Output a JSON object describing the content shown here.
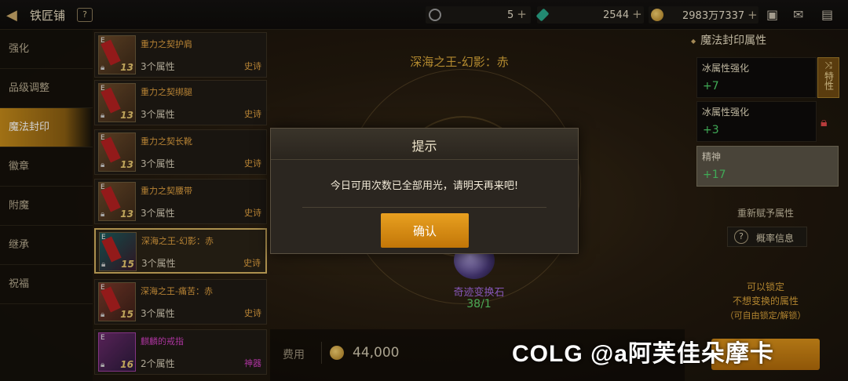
{
  "header": {
    "title": "铁匠铺",
    "help_glyph": "?",
    "currencies": [
      {
        "icon": "clock-token-icon",
        "value": "5"
      },
      {
        "icon": "green-crystal-icon",
        "value": "2544"
      },
      {
        "icon": "gold-coin-icon",
        "value": "2983万7337"
      }
    ],
    "plus_glyph": "+"
  },
  "nav": {
    "items": [
      "强化",
      "品级调整",
      "魔法封印",
      "徽章",
      "附魔",
      "继承",
      "祝福"
    ],
    "active_index": 2
  },
  "items": [
    {
      "name": "重力之契护肩",
      "attrs": "3个属性",
      "rarity": "史诗",
      "level": "13"
    },
    {
      "name": "重力之契绑腿",
      "attrs": "3个属性",
      "rarity": "史诗",
      "level": "13"
    },
    {
      "name": "重力之契长靴",
      "attrs": "3个属性",
      "rarity": "史诗",
      "level": "13"
    },
    {
      "name": "重力之契腰带",
      "attrs": "3个属性",
      "rarity": "史诗",
      "level": "13"
    },
    {
      "name": "深海之王-幻影：赤",
      "attrs": "3个属性",
      "rarity": "史诗",
      "level": "15"
    },
    {
      "name": "深海之王-痛苦：赤",
      "attrs": "3个属性",
      "rarity": "史诗",
      "level": "15"
    },
    {
      "name": "麒麟的戒指",
      "attrs": "2个属性",
      "rarity": "神器",
      "level": "16"
    }
  ],
  "selected_item_index": 4,
  "center": {
    "item_title": "深海之王-幻影：赤",
    "stone_name": "奇迹变换石",
    "stone_count": "38/1",
    "fee_label": "费用",
    "fee_value": "44,000"
  },
  "right_panel": {
    "title": "魔法封印属性",
    "attributes": [
      {
        "name": "冰属性强化",
        "value": "+7"
      },
      {
        "name": "冰属性强化",
        "value": "+3"
      },
      {
        "name": "精神",
        "value": "+17"
      }
    ],
    "trait_button": "特性",
    "reassign_label": "重新赋予属性",
    "probability_button": "概率信息",
    "notes": [
      "可以锁定",
      "不想变换的属性",
      "（可自由锁定/解锁）"
    ]
  },
  "dialog": {
    "title": "提示",
    "message": "今日可用次数已全部用光，请明天再来吧!",
    "confirm_label": "确认"
  },
  "watermark": "COLG @a阿芙佳朵摩卡",
  "colors": {
    "accent_orange": "#d8901a",
    "gold_text": "#e0a040",
    "green_value": "#4fcf6a",
    "legendary_purple": "#d040c0"
  }
}
